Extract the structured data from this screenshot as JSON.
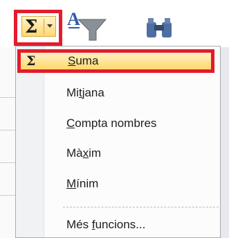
{
  "toolbar": {
    "autosum_symbol": "Σ",
    "autosum_button_name": "AutoSum",
    "filter_icon": "sort-filter-icon",
    "find_icon": "find-select-icon"
  },
  "menu": {
    "items": [
      {
        "icon": "Σ",
        "prefix": "",
        "accel": "S",
        "suffix": "uma"
      },
      {
        "prefix": "Mi",
        "accel": "t",
        "suffix": "jana"
      },
      {
        "prefix": "",
        "accel": "C",
        "suffix": "ompta nombres"
      },
      {
        "prefix": "Mà",
        "accel": "x",
        "suffix": "im"
      },
      {
        "prefix": "",
        "accel": "M",
        "suffix": "ínim"
      },
      {
        "prefix": "Més ",
        "accel": "f",
        "suffix": "uncions..."
      }
    ]
  },
  "colors": {
    "highlight_border": "#e31c2b",
    "selected_fill": "#ffd96b"
  }
}
